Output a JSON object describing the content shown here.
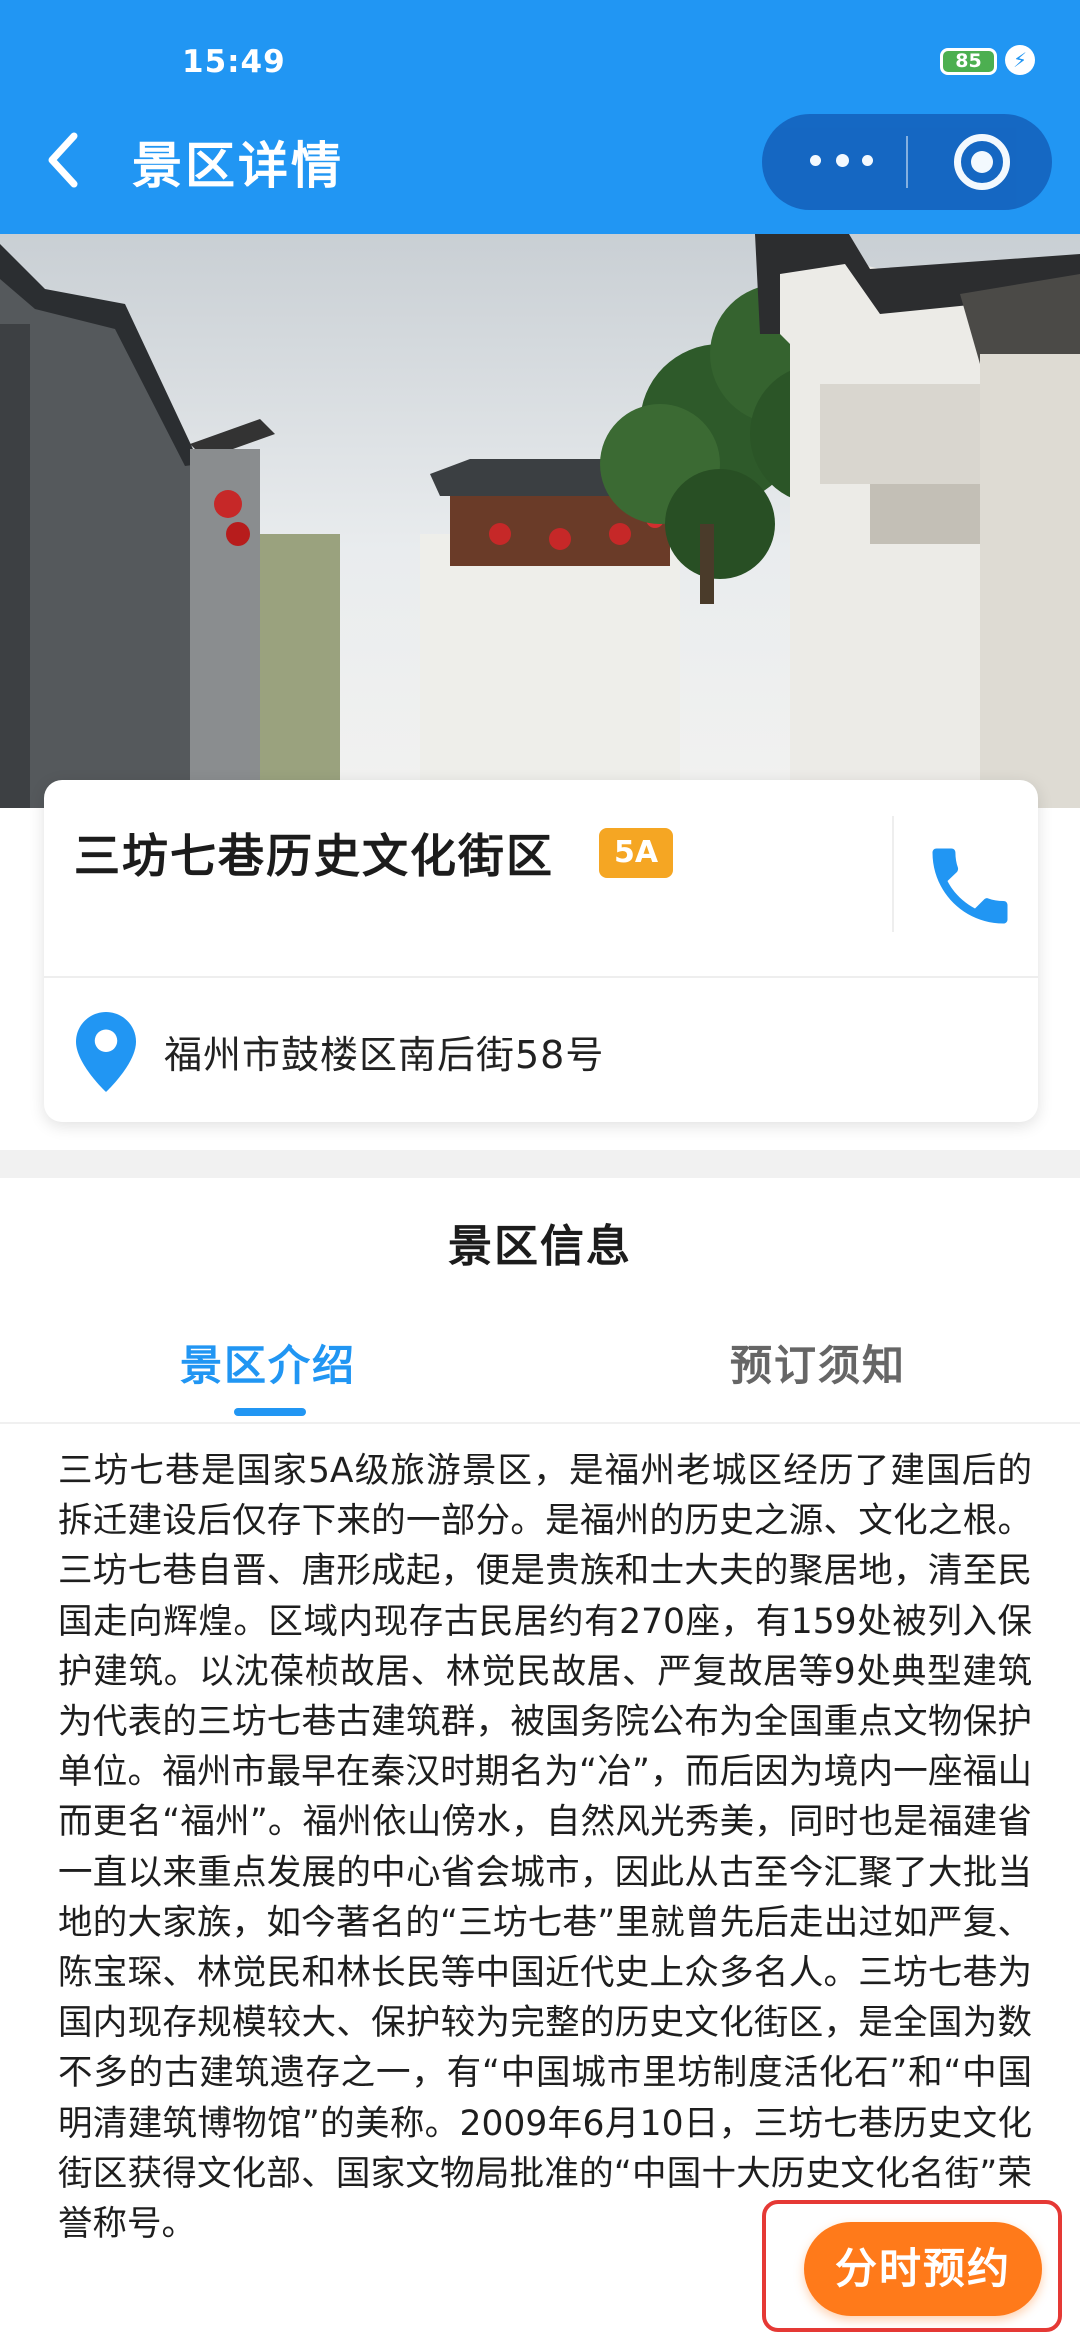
{
  "status_bar": {
    "time": "15:49",
    "battery": "85"
  },
  "header": {
    "title": "景区详情"
  },
  "spot": {
    "name": "三坊七巷历史文化街区",
    "level": "5A",
    "address": "福州市鼓楼区南后街58号"
  },
  "info_section": {
    "title": "景区信息",
    "tabs": [
      {
        "label": "景区介绍",
        "active": true
      },
      {
        "label": "预订须知",
        "active": false
      }
    ],
    "intro": "三坊七巷是国家5A级旅游景区，是福州老城区经历了建国后的拆迁建设后仅存下来的一部分。是福州的历史之源、文化之根。三坊七巷自晋、唐形成起，便是贵族和士大夫的聚居地，清至民国走向辉煌。区域内现存古民居约有270座，有159处被列入保护建筑。以沈葆桢故居、林觉民故居、严复故居等9处典型建筑为代表的三坊七巷古建筑群，被国务院公布为全国重点文物保护单位。福州市最早在秦汉时期名为“冶”，而后因为境内一座福山而更名“福州”。福州依山傍水，自然风光秀美，同时也是福建省一直以来重点发展的中心省会城市，因此从古至今汇聚了大批当地的大家族，如今著名的“三坊七巷”里就曾先后走出过如严复、陈宝琛、林觉民和林长民等中国近代史上众多名人。三坊七巷为国内现存规模较大、保护较为完整的历史文化街区，是全国为数不多的古建筑遗存之一，有“中国城市里坊制度活化石”和“中国明清建筑博物馆”的美称。2009年6月10日，三坊七巷历史文化街区获得文化部、国家文物局批准的“中国十大历史文化名街”荣誉称号。"
  },
  "booking": {
    "button_label": "分时预约"
  },
  "colors": {
    "primary": "#2196f3",
    "badge": "#f5a623",
    "booking": "#ff7a1a",
    "highlight": "#e53935"
  },
  "icons": {
    "back": "back-arrow-icon",
    "more": "more-dots-icon",
    "close": "capsule-close-icon",
    "phone": "phone-icon",
    "location": "location-pin-icon",
    "bolt": "charging-bolt-icon"
  }
}
